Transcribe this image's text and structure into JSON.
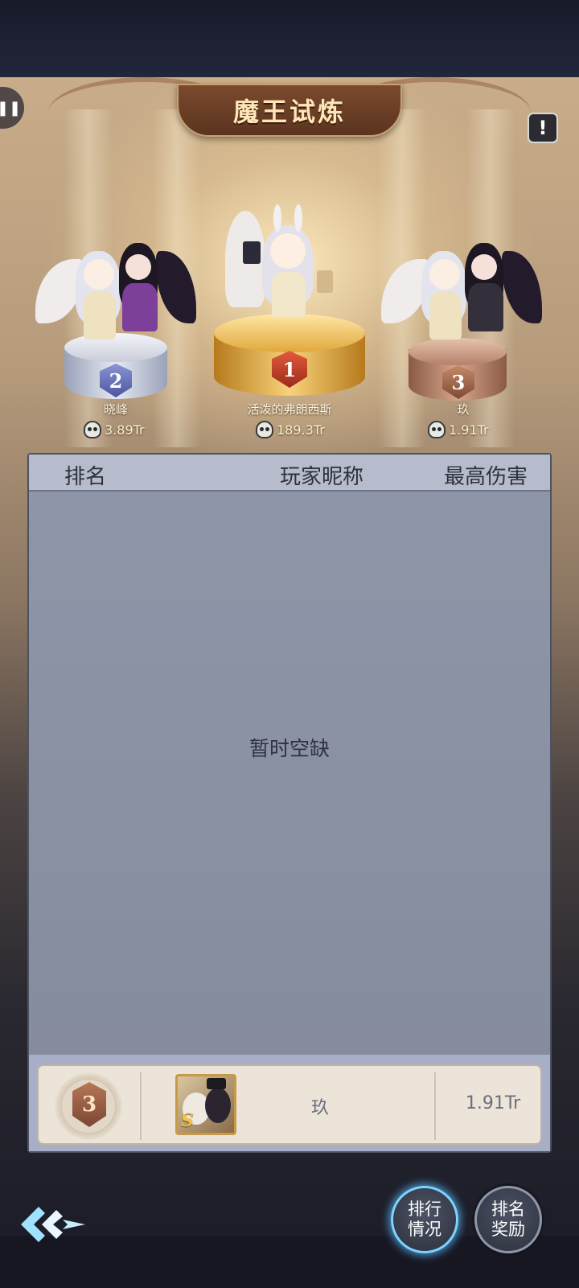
{
  "title": "魔王试炼",
  "podium": [
    {
      "rank": "2",
      "name": "晓峰",
      "score": "3.89Tr"
    },
    {
      "rank": "1",
      "name": "活泼的弗朗西斯",
      "score": "189.3Tr"
    },
    {
      "rank": "3",
      "name": "玖",
      "score": "1.91Tr"
    }
  ],
  "table": {
    "headers": {
      "rank": "排名",
      "player": "玩家昵称",
      "damage": "最高伤害"
    },
    "empty_text": "暂时空缺"
  },
  "my_row": {
    "rank": "3",
    "name": "玖",
    "score": "1.91Tr",
    "grade": "S"
  },
  "buttons": {
    "ranking": [
      "排行",
      "情况"
    ],
    "rewards": [
      "排名",
      "奖励"
    ]
  },
  "colors": {
    "gold": "#e0a83b",
    "silver": "#c9ccd8",
    "bronze": "#b4806a",
    "active_glow": "#7ed3ff"
  }
}
